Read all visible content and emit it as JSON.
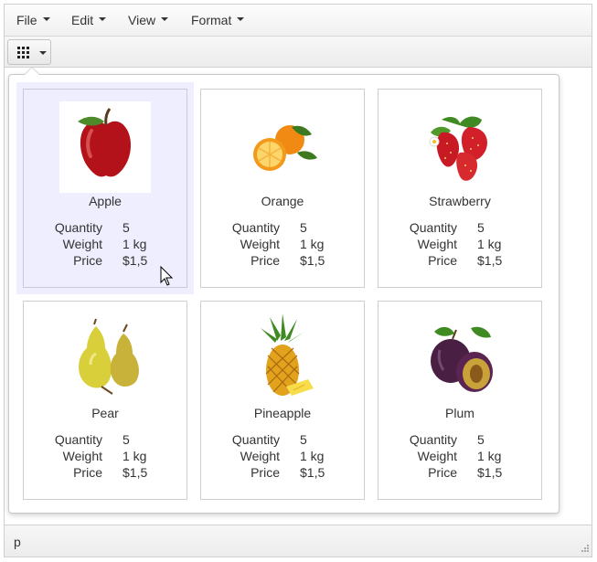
{
  "menu": {
    "items": [
      {
        "label": "File"
      },
      {
        "label": "Edit"
      },
      {
        "label": "View"
      },
      {
        "label": "Format"
      }
    ]
  },
  "toolbar": {
    "view_button_icon": "grid-icon",
    "caret_icon": "chevron-down-icon"
  },
  "popup": {
    "selected_index": 0,
    "cards": [
      {
        "name": "Apple",
        "icon": "apple-image",
        "props": [
          {
            "label": "Quantity",
            "value": "5"
          },
          {
            "label": "Weight",
            "value": "1 kg"
          },
          {
            "label": "Price",
            "value": "$1,5"
          }
        ]
      },
      {
        "name": "Orange",
        "icon": "orange-image",
        "props": [
          {
            "label": "Quantity",
            "value": "5"
          },
          {
            "label": "Weight",
            "value": "1 kg"
          },
          {
            "label": "Price",
            "value": "$1,5"
          }
        ]
      },
      {
        "name": "Strawberry",
        "icon": "strawberry-image",
        "props": [
          {
            "label": "Quantity",
            "value": "5"
          },
          {
            "label": "Weight",
            "value": "1 kg"
          },
          {
            "label": "Price",
            "value": "$1,5"
          }
        ]
      },
      {
        "name": "Pear",
        "icon": "pear-image",
        "props": [
          {
            "label": "Quantity",
            "value": "5"
          },
          {
            "label": "Weight",
            "value": "1 kg"
          },
          {
            "label": "Price",
            "value": "$1,5"
          }
        ]
      },
      {
        "name": "Pineapple",
        "icon": "pineapple-image",
        "props": [
          {
            "label": "Quantity",
            "value": "5"
          },
          {
            "label": "Weight",
            "value": "1 kg"
          },
          {
            "label": "Price",
            "value": "$1,5"
          }
        ]
      },
      {
        "name": "Plum",
        "icon": "plum-image",
        "props": [
          {
            "label": "Quantity",
            "value": "5"
          },
          {
            "label": "Weight",
            "value": "1 kg"
          },
          {
            "label": "Price",
            "value": "$1,5"
          }
        ]
      }
    ]
  },
  "statusbar": {
    "text": "p"
  },
  "colors": {
    "selected_card_bg": "#eeeeff",
    "border": "#cfcfcf",
    "text": "#333333"
  }
}
